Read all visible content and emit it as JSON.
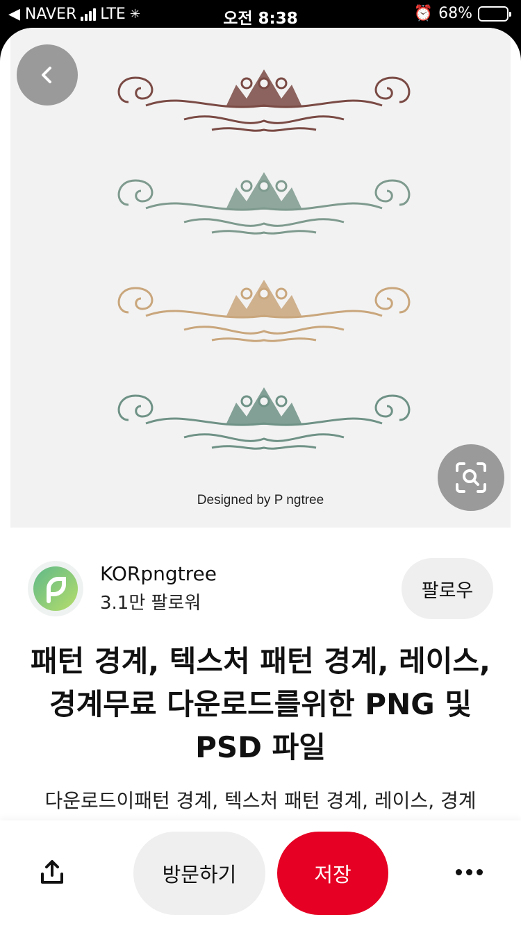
{
  "status_bar": {
    "carrier": "◀ NAVER",
    "network": "LTE",
    "time": "오전 8:38",
    "battery": "68%",
    "battery_level": 0.68
  },
  "hero": {
    "watermark": "Designed by P ngtree",
    "ornament_colors": [
      "#7a4a44",
      "#7e9a8e",
      "#c9a67c",
      "#6f9286"
    ]
  },
  "creator": {
    "name": "KORpngtree",
    "followers": "3.1만 팔로워",
    "follow_label": "팔로우"
  },
  "pin": {
    "title": "패턴 경계, 텍스처 패턴 경계, 레이스, 경계무료 다운로드를위한 PNG 및 PSD 파일",
    "description": "다운로드이패턴 경계, 텍스처 패턴 경계, 레이스, 경계"
  },
  "actions": {
    "visit_label": "방문하기",
    "save_label": "저장"
  },
  "colors": {
    "save": "#e60023",
    "button_bg": "#efefef"
  }
}
